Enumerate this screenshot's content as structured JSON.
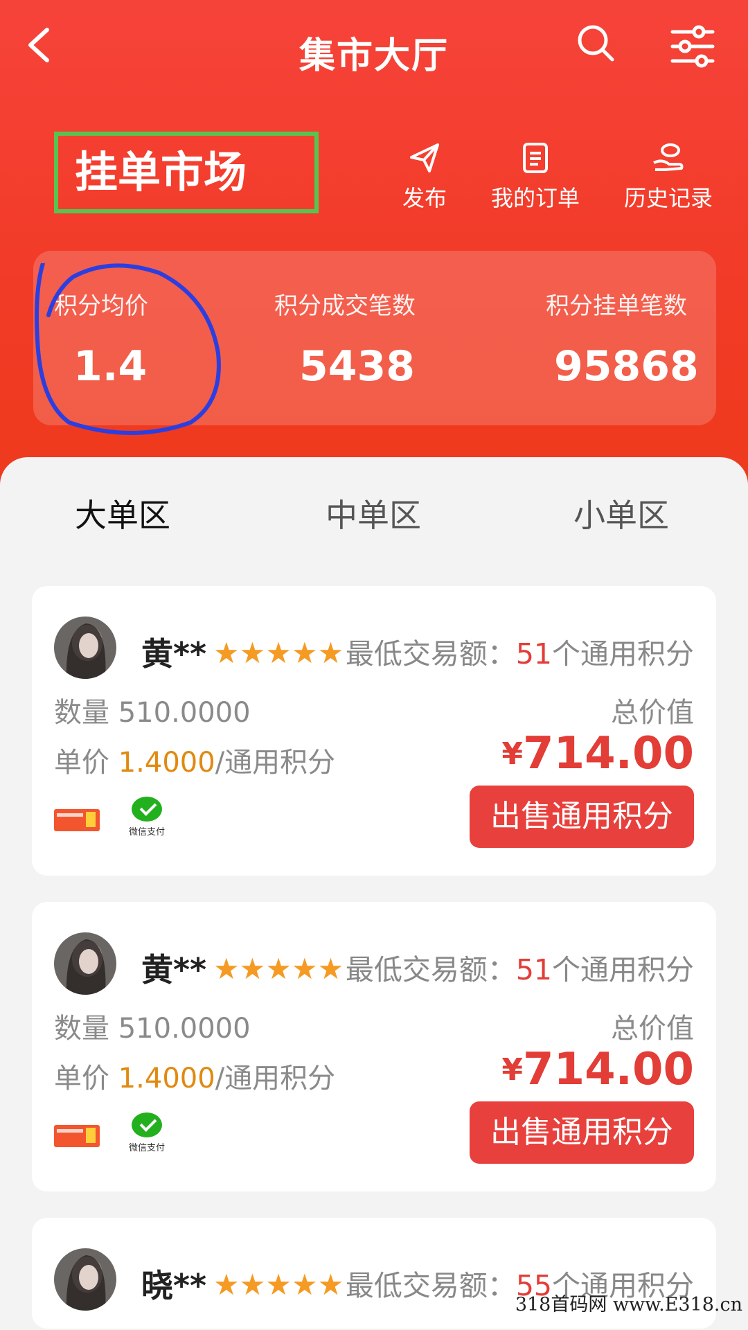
{
  "header": {
    "title": "集市大厅"
  },
  "market": {
    "title": "挂单市场",
    "actions": [
      {
        "label": "发布",
        "icon": "paper-plane-icon"
      },
      {
        "label": "我的订单",
        "icon": "document-icon"
      },
      {
        "label": "历史记录",
        "icon": "history-hand-icon"
      }
    ]
  },
  "stats": [
    {
      "label": "积分均价",
      "value": "1.4"
    },
    {
      "label": "积分成交笔数",
      "value": "5438"
    },
    {
      "label": "积分挂单笔数",
      "value": "95868"
    }
  ],
  "tabs": [
    {
      "label": "大单区",
      "active": true
    },
    {
      "label": "中单区",
      "active": false
    },
    {
      "label": "小单区",
      "active": false
    }
  ],
  "orders": [
    {
      "name": "黄**",
      "rating": 5,
      "min_label": "最低交易额：",
      "min_value": "51",
      "min_unit": "个通用积分",
      "qty_label": "数量",
      "qty": "510.0000",
      "price_label": "单价",
      "price": "1.4000",
      "price_unit": "/通用积分",
      "total_label": "总价值",
      "total_currency": "¥",
      "total": "714.00",
      "pay_label": "微信支付",
      "button": "出售通用积分"
    },
    {
      "name": "黄**",
      "rating": 5,
      "min_label": "最低交易额：",
      "min_value": "51",
      "min_unit": "个通用积分",
      "qty_label": "数量",
      "qty": "510.0000",
      "price_label": "单价",
      "price": "1.4000",
      "price_unit": "/通用积分",
      "total_label": "总价值",
      "total_currency": "¥",
      "total": "714.00",
      "pay_label": "微信支付",
      "button": "出售通用积分"
    },
    {
      "name": "晓**",
      "rating": 5,
      "min_label": "最低交易额：",
      "min_value": "55",
      "min_unit": "个通用积分"
    }
  ],
  "watermark": "318首码网 www.E318.cn",
  "colors": {
    "primary_red": "#f23b28",
    "price_red": "#e23d36",
    "price_orange": "#e08a10",
    "star": "#f59a23",
    "wechat_green": "#23b01f"
  }
}
